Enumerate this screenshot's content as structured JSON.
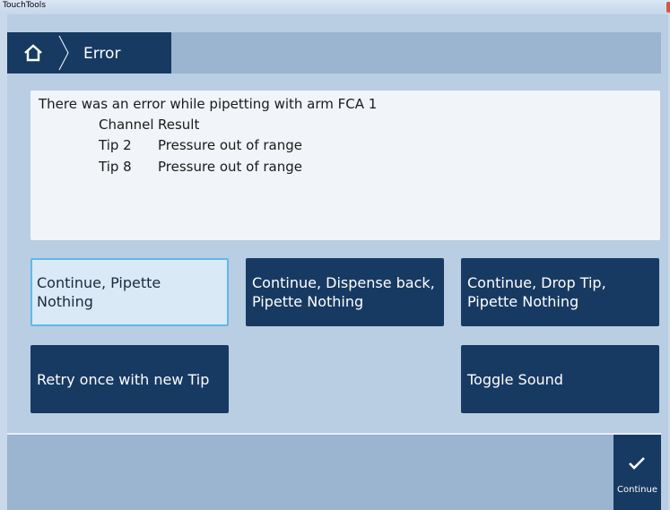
{
  "window": {
    "title": "TouchTools"
  },
  "header": {
    "home_icon": "home-icon",
    "breadcrumb_label": "Error"
  },
  "message": {
    "intro": "There was an error while pipetting with arm FCA 1",
    "columns": [
      "Channel",
      "Result"
    ],
    "rows": [
      {
        "channel": "Tip 2",
        "result": "Pressure out of range"
      },
      {
        "channel": "Tip 8",
        "result": "Pressure out of range"
      }
    ]
  },
  "actions": {
    "continue_pipette_nothing": "Continue, Pipette\nNothing",
    "continue_dispense_back": "Continue, Dispense back,\nPipette Nothing",
    "continue_drop_tip": "Continue, Drop Tip,\nPipette Nothing",
    "retry_new_tip": "Retry once with new Tip",
    "toggle_sound": "Toggle Sound"
  },
  "footer": {
    "continue_label": "Continue",
    "continue_icon": "checkmark-icon"
  },
  "colors": {
    "accent_dark": "#173a63",
    "selected_bg": "#d9e9f5",
    "selected_border": "#5fb8e8",
    "panel_bg": "#b9cde3"
  }
}
